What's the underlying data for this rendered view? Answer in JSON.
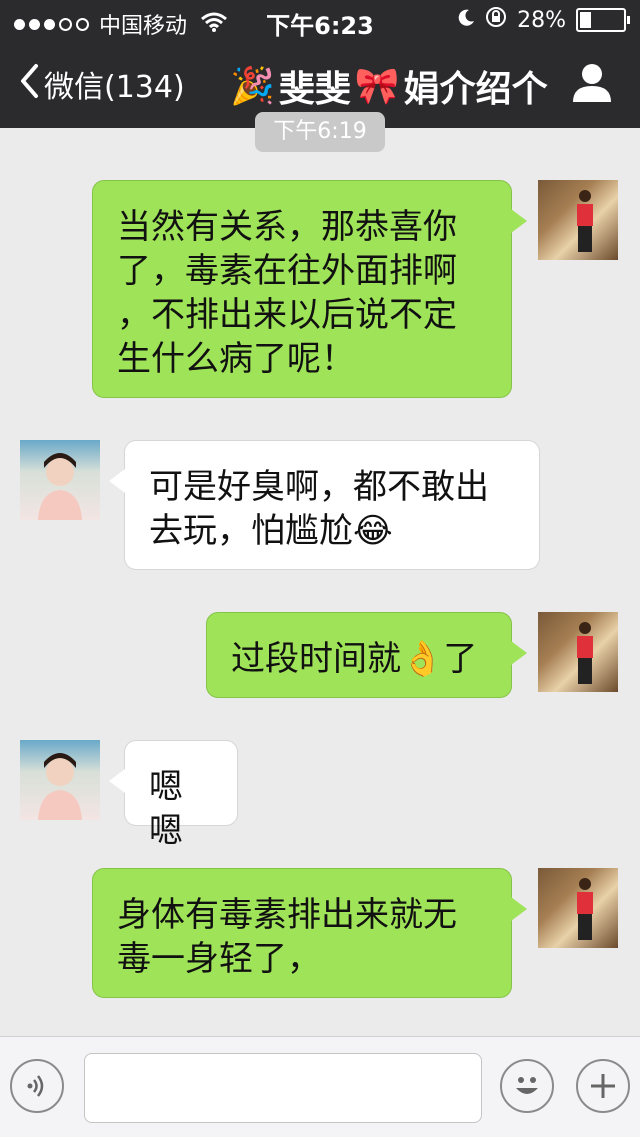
{
  "status_bar": {
    "carrier": "中国移动",
    "time": "下午6:23",
    "battery": "28%",
    "battery_level": 0.28
  },
  "nav": {
    "back_label": "微信(134)",
    "title": "斐斐",
    "title_suffix": "娟介绍个",
    "title_prefix_emoji": "🎉",
    "title_mid_emoji": "🎀",
    "right_icon": "contact-icon"
  },
  "chat": {
    "timestamp": "下午6:19",
    "messages": [
      {
        "side": "right",
        "lines": [
          "当然有关系，那恭喜你",
          "了，毒素在往外面排啊",
          "，不排出来以后说不定",
          "生什么病了呢！"
        ]
      },
      {
        "side": "left",
        "lines": [
          "可是好臭啊，都不敢出",
          "去玩，怕尴尬😂"
        ]
      },
      {
        "side": "right",
        "lines": [
          "过段时间就👌了"
        ]
      },
      {
        "side": "left",
        "lines": [
          "嗯嗯"
        ]
      },
      {
        "side": "right",
        "lines": [
          "身体有毒素排出来就无",
          "毒一身轻了，"
        ]
      }
    ]
  },
  "input": {
    "value": "",
    "voice_icon": "voice-icon",
    "emoji_icon": "emoji-icon",
    "plus_icon": "plus-icon"
  },
  "colors": {
    "header_bg": "#2b2b2e",
    "chat_bg": "#ebebeb",
    "my_bubble": "#9fe358",
    "their_bubble": "#ffffff"
  }
}
